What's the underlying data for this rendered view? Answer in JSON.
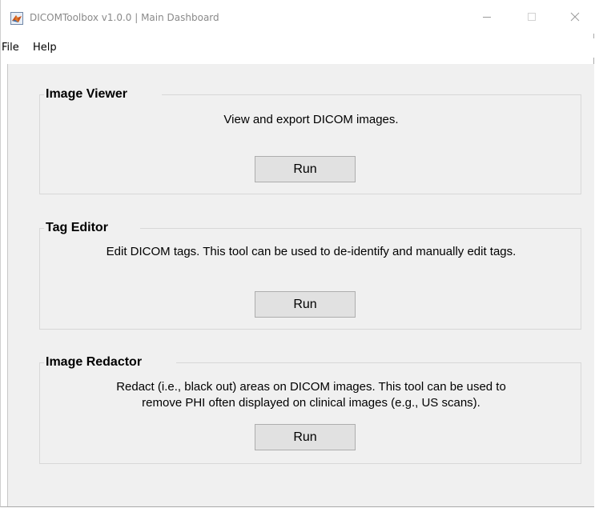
{
  "window": {
    "title": "DICOMToolbox v1.0.0 | Main Dashboard",
    "icon": "matlab-icon"
  },
  "menubar": {
    "items": [
      {
        "label": "File"
      },
      {
        "label": "Help"
      }
    ]
  },
  "panels": [
    {
      "title": "Image Viewer",
      "description_lines": [
        "View and export DICOM images."
      ],
      "button_label": "Run"
    },
    {
      "title": "Tag Editor",
      "description_lines": [
        "Edit DICOM tags. This tool can be used to de-identify and manually edit tags."
      ],
      "button_label": "Run"
    },
    {
      "title": "Image Redactor",
      "description_lines": [
        "Redact (i.e., black out) areas on DICOM images. This tool can be used to",
        "remove PHI often displayed on clinical images (e.g., US scans)."
      ],
      "button_label": "Run"
    }
  ],
  "colors": {
    "panel_background": "#f0f0f0",
    "button_background": "#e1e1e1",
    "button_border": "#adadad",
    "title_text": "#8a8a8a"
  }
}
